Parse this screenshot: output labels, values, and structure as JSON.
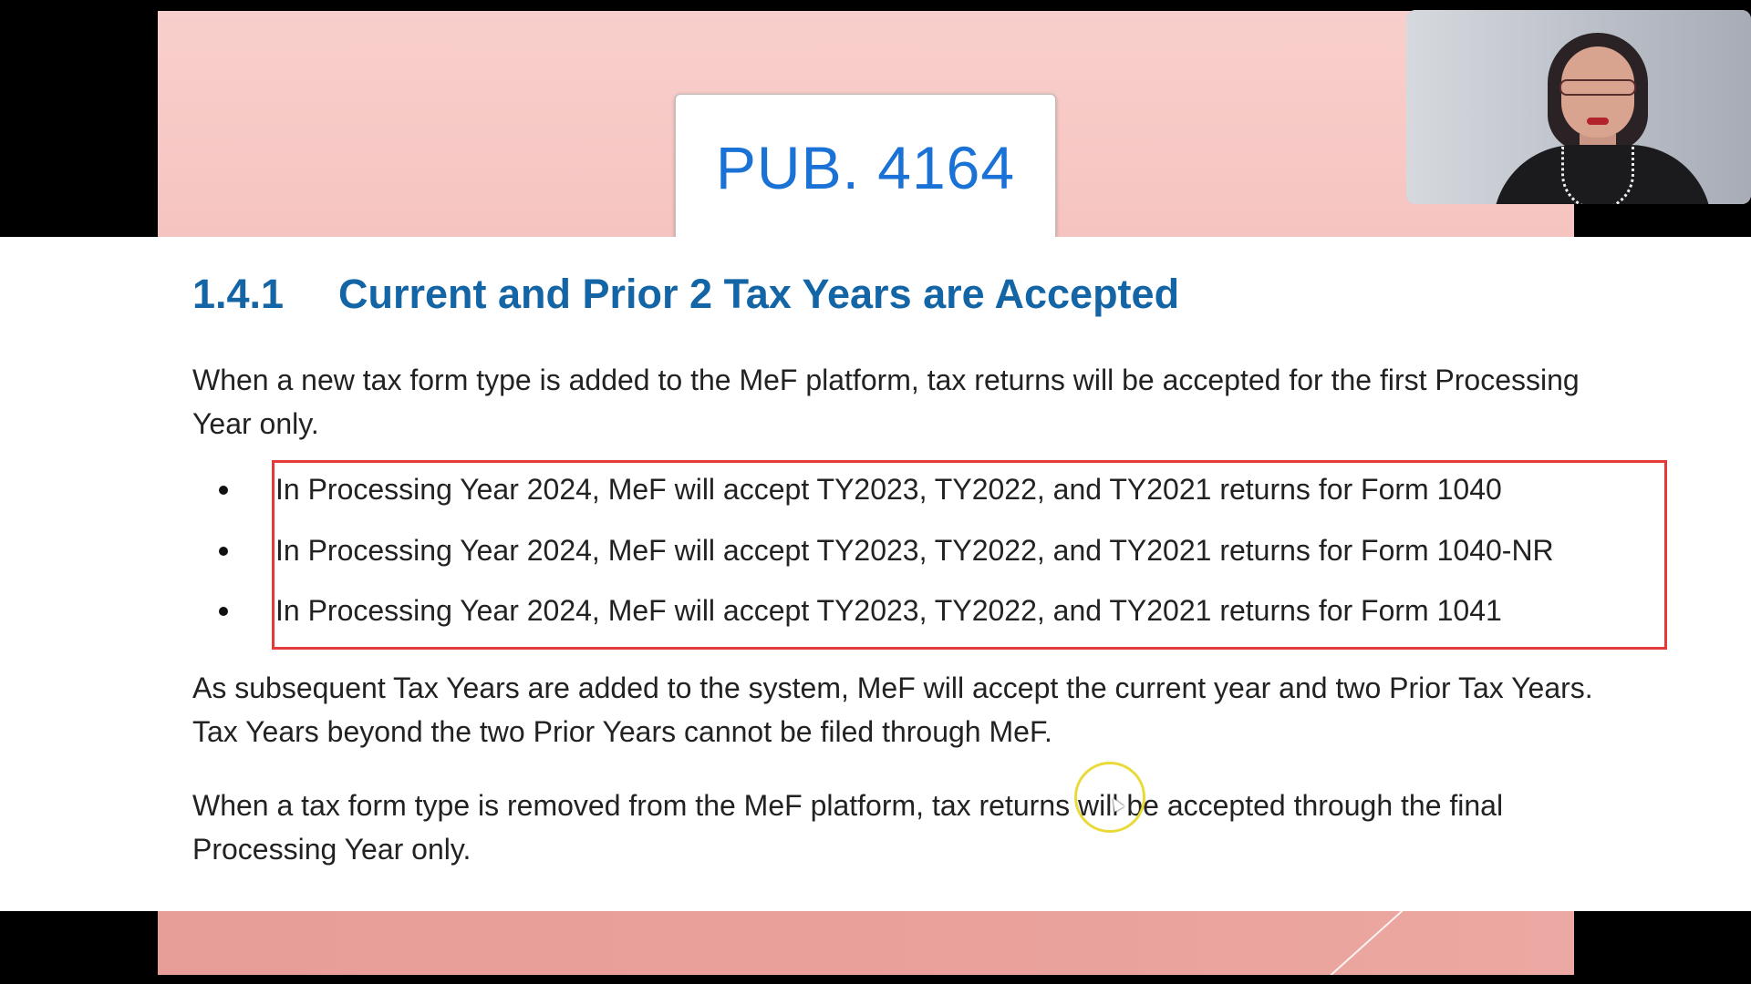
{
  "slide": {
    "title_box": "PUB. 4164"
  },
  "document": {
    "section_number": "1.4.1",
    "section_title": "Current and Prior 2 Tax Years are Accepted",
    "para1": "When a new tax form type is added to the MeF platform, tax returns will be accepted for the first Processing Year only.",
    "bullets": [
      "In Processing Year 2024, MeF will accept TY2023, TY2022, and TY2021 returns for Form 1040",
      "In Processing Year 2024, MeF will accept TY2023, TY2022, and TY2021 returns for Form 1040-NR",
      "In Processing Year 2024, MeF will accept TY2023, TY2022, and TY2021 returns for Form 1041"
    ],
    "para2": "As subsequent Tax Years are added to the system, MeF will accept the current year and two Prior Tax Years. Tax Years beyond the two Prior Years cannot be filed through MeF.",
    "para3": "When a tax form type is removed from the MeF platform, tax returns will be accepted through the final Processing Year only."
  },
  "colors": {
    "heading": "#1465a6",
    "title_text": "#1a72d6",
    "highlight_border": "#e43a3a",
    "slide_pink": "#f6c4c0",
    "cursor_ring": "#e9da3a"
  }
}
